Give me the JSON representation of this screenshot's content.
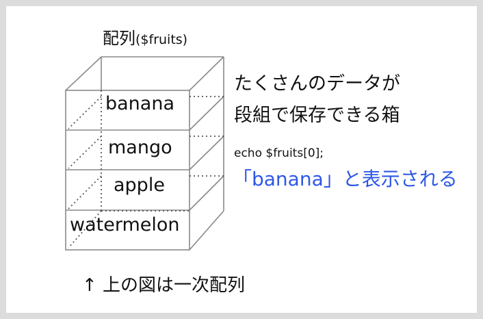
{
  "diagram": {
    "title_main": "配列",
    "title_var": "($fruits)",
    "cells": [
      "banana",
      "mango",
      "apple",
      "watermelon"
    ],
    "description_line1": "たくさんのデータが",
    "description_line2": "段組で保存できる箱",
    "code": "echo $fruits[0];",
    "result": "「banana」と表示される",
    "caption": "↑ 上の図は一次配列"
  },
  "colors": {
    "frame_border": "#dcdcdc",
    "box_stroke": "#888888",
    "result_text": "#2d57e6",
    "text": "#111111"
  }
}
